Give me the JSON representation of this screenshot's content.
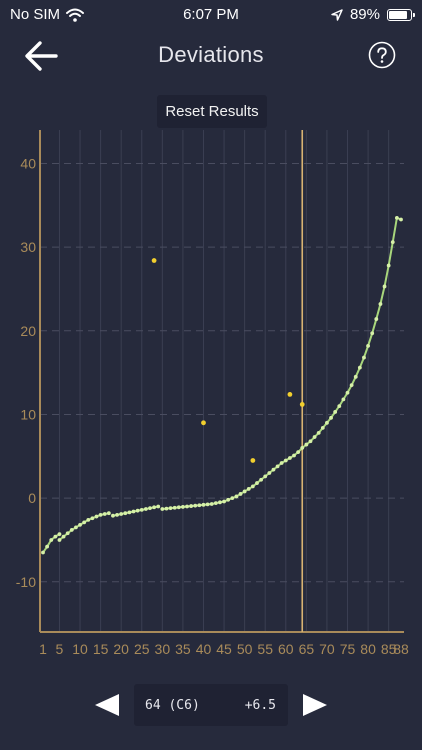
{
  "status_bar": {
    "carrier": "No SIM",
    "time": "6:07 PM",
    "battery": "89%",
    "battery_level": 0.89
  },
  "header": {
    "title": "Deviations"
  },
  "actions": {
    "reset_label": "Reset Results"
  },
  "selection": {
    "note": "64 (C6)",
    "cents": "+6.5"
  },
  "colors": {
    "background": "#262a3c",
    "axis": "#a98b5a",
    "curve": "#a8d67c",
    "measured": "#f2cf2e",
    "cursor": "#d8b373"
  },
  "chart_data": {
    "type": "scatter",
    "xlim": [
      1,
      88
    ],
    "ylim": [
      -16,
      44
    ],
    "x_ticks": [
      1,
      5,
      10,
      15,
      20,
      25,
      30,
      35,
      40,
      45,
      50,
      55,
      60,
      65,
      70,
      75,
      80,
      85,
      88
    ],
    "y_ticks": [
      -10,
      0,
      10,
      20,
      30,
      40
    ],
    "cursor_x": 64,
    "grid": true,
    "curve_segments": [
      {
        "x": [
          1,
          2,
          3,
          4,
          5
        ],
        "y": [
          -6.5,
          -5.8,
          -5.0,
          -4.6,
          -4.3
        ]
      },
      {
        "x": [
          5,
          6,
          7,
          8,
          9,
          10,
          11,
          12,
          13,
          14,
          15,
          16,
          17
        ],
        "y": [
          -5.0,
          -4.6,
          -4.2,
          -3.8,
          -3.5,
          -3.2,
          -2.9,
          -2.6,
          -2.4,
          -2.2,
          -2.0,
          -1.9,
          -1.8
        ]
      },
      {
        "x": [
          18,
          19,
          20,
          21,
          22,
          23,
          24,
          25,
          26,
          27,
          28,
          29
        ],
        "y": [
          -2.1,
          -2.0,
          -1.9,
          -1.8,
          -1.7,
          -1.6,
          -1.5,
          -1.4,
          -1.3,
          -1.2,
          -1.1,
          -1.0
        ]
      },
      {
        "x": [
          30,
          31,
          32,
          33,
          34,
          35,
          36,
          37,
          38,
          39,
          40,
          41,
          42,
          43,
          44,
          45,
          46,
          47,
          48,
          49,
          50,
          51,
          52,
          53,
          54,
          55,
          56,
          57,
          58,
          59,
          60,
          61,
          62,
          63,
          64,
          65,
          66,
          67,
          68,
          69,
          70,
          71,
          72,
          73,
          74,
          75,
          76,
          77,
          78,
          79,
          80,
          81,
          82,
          83,
          84,
          85,
          86,
          87,
          88
        ],
        "y": [
          -1.3,
          -1.25,
          -1.2,
          -1.15,
          -1.1,
          -1.05,
          -1.0,
          -0.95,
          -0.9,
          -0.85,
          -0.8,
          -0.75,
          -0.7,
          -0.6,
          -0.5,
          -0.4,
          -0.2,
          0.0,
          0.2,
          0.5,
          0.8,
          1.1,
          1.4,
          1.8,
          2.2,
          2.6,
          3.0,
          3.4,
          3.8,
          4.2,
          4.5,
          4.8,
          5.1,
          5.5,
          6.0,
          6.4,
          6.8,
          7.3,
          7.8,
          8.4,
          9.0,
          9.6,
          10.3,
          11.0,
          11.8,
          12.6,
          13.5,
          14.5,
          15.6,
          16.8,
          18.2,
          19.7,
          21.4,
          23.2,
          25.3,
          27.8,
          30.6,
          33.5,
          33.3
        ]
      }
    ],
    "measured_points": {
      "x": [
        28,
        40,
        52,
        61,
        64
      ],
      "y": [
        28.4,
        9.0,
        4.5,
        12.4,
        11.2
      ]
    }
  }
}
